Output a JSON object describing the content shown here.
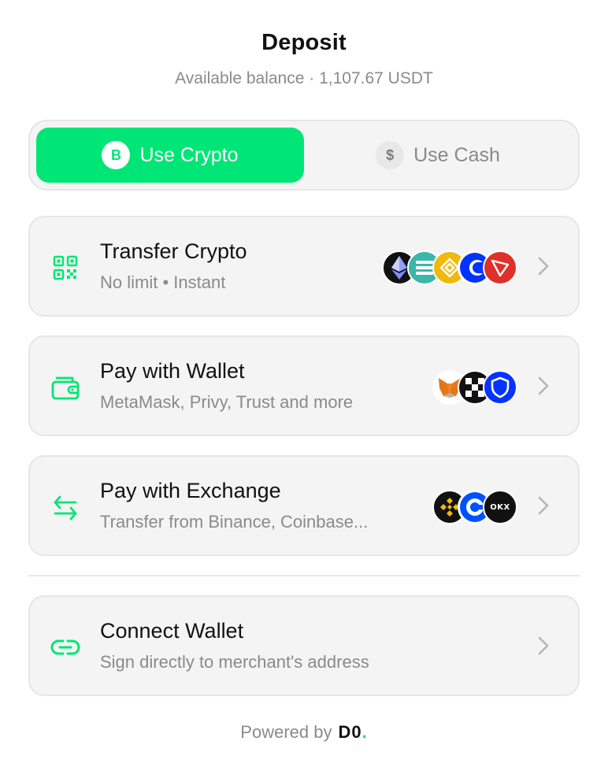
{
  "header": {
    "title": "Deposit",
    "balance": "Available balance · 1,107.67 USDT"
  },
  "toggle": {
    "crypto": {
      "label": "Use Crypto",
      "glyph": "B",
      "icon": "bitcoin-icon",
      "active": true
    },
    "cash": {
      "label": "Use Cash",
      "glyph": "$",
      "icon": "dollar-icon",
      "active": false
    }
  },
  "options": [
    {
      "title": "Transfer Crypto",
      "subtitle": "No limit • Instant",
      "icon": "qr-code-icon",
      "logos": [
        "ethereum-logo",
        "solana-logo",
        "bnb-logo",
        "coinbase-base-logo",
        "tron-logo"
      ]
    },
    {
      "title": "Pay with Wallet",
      "subtitle": "MetaMask, Privy, Trust and more",
      "icon": "wallet-icon",
      "logos": [
        "metamask-logo",
        "privy-logo",
        "trust-wallet-logo"
      ]
    },
    {
      "title": "Pay with Exchange",
      "subtitle": "Transfer from Binance, Coinbase...",
      "icon": "swap-arrows-icon",
      "logos": [
        "binance-logo",
        "coinbase-logo",
        "okx-logo"
      ],
      "logo_text": {
        "okx": "OKX"
      }
    },
    {
      "title": "Connect Wallet",
      "subtitle": "Sign directly to merchant's address",
      "icon": "link-icon",
      "logos": []
    }
  ],
  "footer": {
    "powered_by": "Powered by",
    "brand": "D0",
    "brand_dot": "."
  },
  "colors": {
    "accent": "#00e676",
    "card_bg": "#f4f4f4",
    "muted_text": "#8a8a8a"
  }
}
